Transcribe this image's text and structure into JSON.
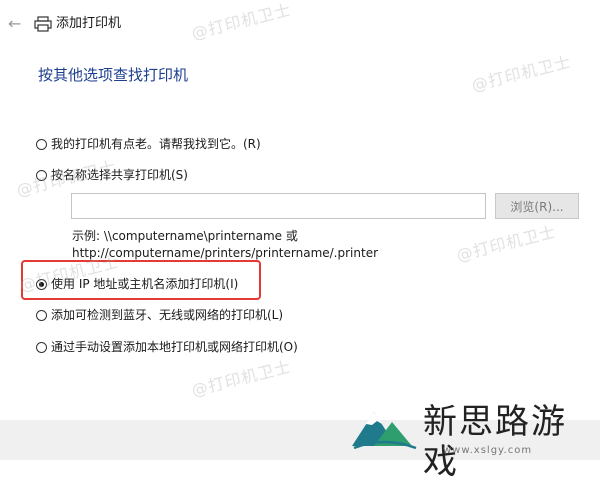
{
  "window": {
    "title": "添加打印机"
  },
  "heading": "按其他选项查找打印机",
  "options": [
    {
      "label": "我的打印机有点老。请帮我找到它。(R)",
      "checked": false
    },
    {
      "label": "按名称选择共享打印机(S)",
      "checked": false
    },
    {
      "label": "使用 IP 地址或主机名添加打印机(I)",
      "checked": true
    },
    {
      "label": "添加可检测到蓝牙、无线或网络的打印机(L)",
      "checked": false
    },
    {
      "label": "通过手动设置添加本地打印机或网络打印机(O)",
      "checked": false
    }
  ],
  "share": {
    "input_value": "",
    "browse_label": "浏览(R)...",
    "example_line1": "示例: \\\\computername\\printername 或",
    "example_line2": "http://computername/printers/printername/.printer"
  },
  "watermark": "@打印机卫士",
  "logo": {
    "name": "新思路游戏",
    "url": "www.xslgy.com"
  },
  "colors": {
    "heading": "#1c3f8f",
    "highlight": "#e53935",
    "button_bg": "#e6e6e6"
  },
  "icons": {
    "back": "arrow-left-icon",
    "app": "printer-icon"
  }
}
